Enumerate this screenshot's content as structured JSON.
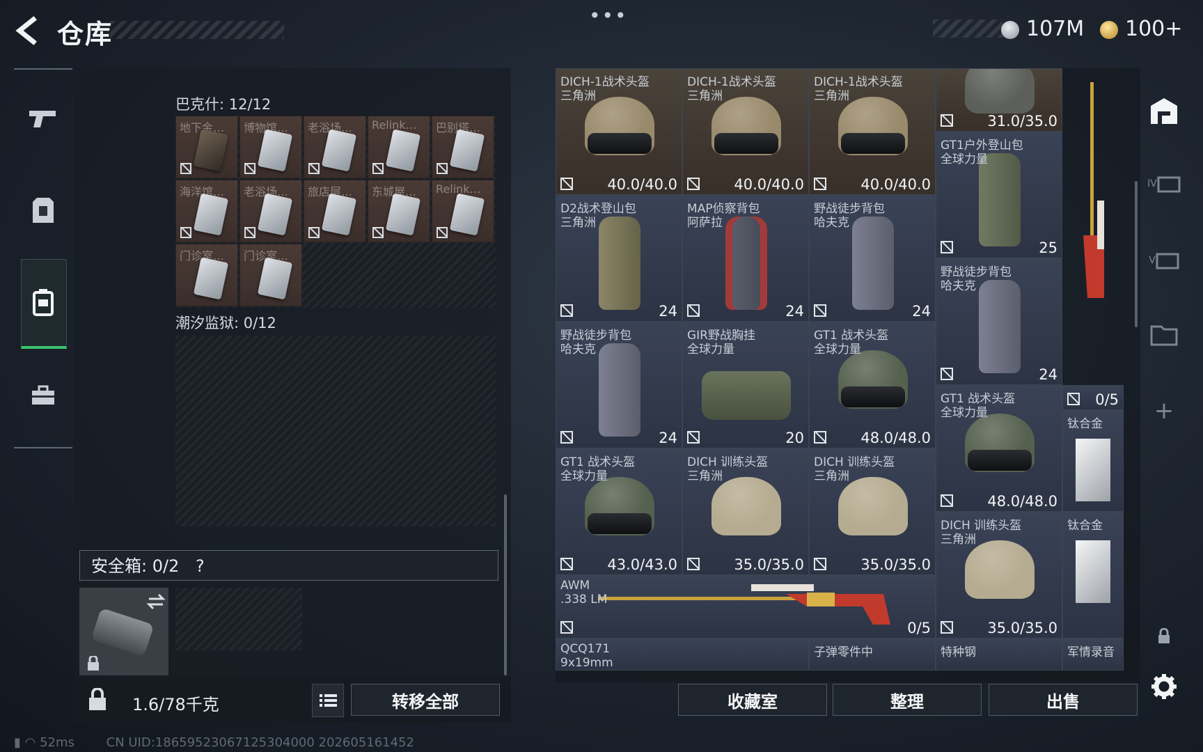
{
  "header": {
    "title": "仓库",
    "money": "107M",
    "gold": "100+",
    "menu_dots": "•••"
  },
  "stash": {
    "section1_label": "巴克什: 12/12",
    "cells": [
      {
        "label": "地下金…",
        "dark": true
      },
      {
        "label": "博物馆…"
      },
      {
        "label": "老浴场…"
      },
      {
        "label": "Relink…"
      },
      {
        "label": "巴别塔…"
      },
      {
        "label": "海洋馆…"
      },
      {
        "label": "老浴场…"
      },
      {
        "label": "旅店层…"
      },
      {
        "label": "东城屋…"
      },
      {
        "label": "Relink…"
      },
      {
        "label": "门诊室…"
      },
      {
        "label": "门诊室…"
      }
    ],
    "section2_label": "潮汐监狱: 0/12",
    "safe_label": "安全箱: 0/2",
    "safe_help": "?",
    "weight": "1.6/78千克",
    "transfer_all": "转移全部"
  },
  "items": [
    {
      "n1": "DICH-1战术头盔",
      "n2": "三角洲",
      "v": "40.0/40.0",
      "kind": "helmet-tan"
    },
    {
      "n1": "DICH-1战术头盔",
      "n2": "三角洲",
      "v": "40.0/40.0",
      "kind": "helmet-tan"
    },
    {
      "n1": "DICH-1战术头盔",
      "n2": "三角洲",
      "v": "40.0/40.0",
      "kind": "helmet-tan"
    },
    {
      "n1": "",
      "n2": "",
      "v": "31.0/35.0",
      "kind": "helmet-dark"
    },
    {
      "n1": "D2战术登山包",
      "n2": "三角洲",
      "v": "24",
      "kind": "pack-olive"
    },
    {
      "n1": "MAP侦察背包",
      "n2": "阿萨拉",
      "v": "24",
      "kind": "pack-red"
    },
    {
      "n1": "野战徒步背包",
      "n2": "哈夫克",
      "v": "24",
      "kind": "pack-grey"
    },
    {
      "n1": "GT1户外登山包",
      "n2": "全球力量",
      "v": "25",
      "kind": "pack-green"
    },
    {
      "n1": "野战徒步背包",
      "n2": "哈夫克",
      "v": "24",
      "kind": "pack-grey"
    },
    {
      "n1": "GIR野战胸挂",
      "n2": "全球力量",
      "v": "20",
      "kind": "rig"
    },
    {
      "n1": "GT1 战术头盔",
      "n2": "全球力量",
      "v": "48.0/48.0",
      "kind": "helmet-green"
    },
    {
      "n1": "野战徒步背包",
      "n2": "哈夫克",
      "v": "24",
      "kind": "pack-grey"
    },
    {
      "n1": "",
      "n2": "",
      "v": "0/5",
      "kind": "empty"
    },
    {
      "n1": "GT1 战术头盔",
      "n2": "全球力量",
      "v": "48.0/48.0",
      "kind": "helmet-green"
    },
    {
      "n1": "钛合金",
      "n2": "",
      "v": "",
      "kind": "plate"
    },
    {
      "n1": "GT1 战术头盔",
      "n2": "全球力量",
      "v": "43.0/43.0",
      "kind": "helmet-green"
    },
    {
      "n1": "DICH 训练头盔",
      "n2": "三角洲",
      "v": "35.0/35.0",
      "kind": "helmet-camo"
    },
    {
      "n1": "DICH 训练头盔",
      "n2": "三角洲",
      "v": "35.0/35.0",
      "kind": "helmet-camo"
    },
    {
      "n1": "DICH 训练头盔",
      "n2": "三角洲",
      "v": "35.0/35.0",
      "kind": "helmet-camo"
    },
    {
      "n1": "钛合金",
      "n2": "",
      "v": "",
      "kind": "plate"
    },
    {
      "n1": "AWM",
      "n2": ".338 LM",
      "v": "0/5",
      "kind": "rifle"
    },
    {
      "n1": "QCQ171",
      "n2": "9x19mm",
      "v": "",
      "kind": "partial"
    },
    {
      "n1": "子弹零件中",
      "n2": "",
      "v": "",
      "kind": "partial"
    },
    {
      "n1": "特种钢",
      "n2": "",
      "v": "",
      "kind": "partial"
    },
    {
      "n1": "军情录音",
      "n2": "",
      "v": "",
      "kind": "partial"
    }
  ],
  "buttons": {
    "collection": "收藏室",
    "sort": "整理",
    "sell": "出售"
  },
  "rail": {
    "plus": "+",
    "iv": "IV",
    "v": "V"
  },
  "status": {
    "ping": "52ms",
    "uid": "CN UID:1865952306712530400​0 2026051614​52"
  },
  "colors": {
    "accent": "#39c46b",
    "cell_brown": "#3a2e2c",
    "cell_blue": "#2c3344"
  },
  "icons": [
    "back-arrow-icon",
    "pistol-icon",
    "armor-icon",
    "backpack-icon",
    "toolbox-icon",
    "helmet-icon",
    "lock-icon",
    "swap-icon",
    "list-icon",
    "gear-icon",
    "plus-icon"
  ]
}
